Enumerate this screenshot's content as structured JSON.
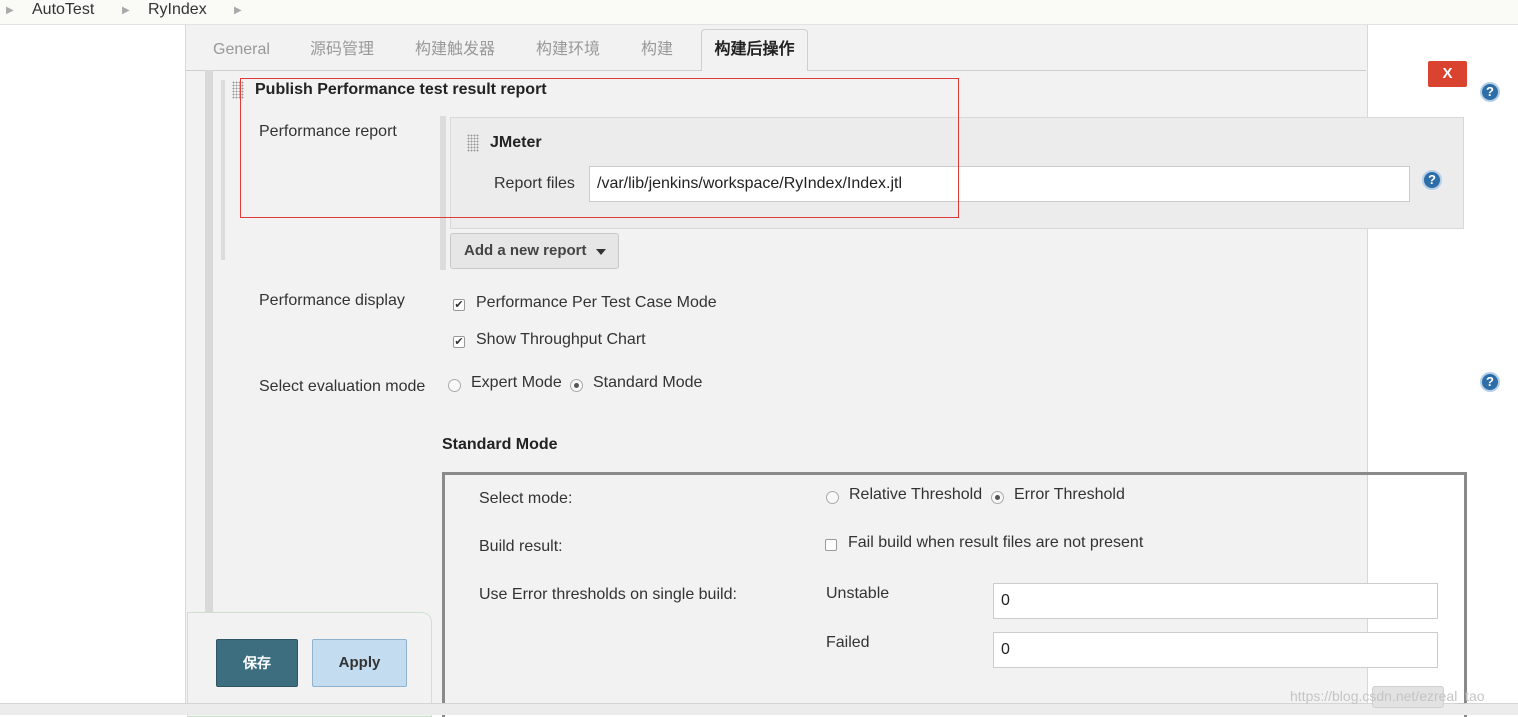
{
  "breadcrumb": {
    "items": [
      "AutoTest",
      "RyIndex"
    ]
  },
  "tabs": {
    "general": "General",
    "scm": "源码管理",
    "triggers": "构建触发器",
    "env": "构建环境",
    "build": "构建",
    "post_build": "构建后操作"
  },
  "close_label": "X",
  "publisher": {
    "title": "Publish Performance test result report",
    "performance_report_label": "Performance report",
    "jmeter_title": "JMeter",
    "report_files_label": "Report files",
    "report_files_value": "/var/lib/jenkins/workspace/RyIndex/Index.jtl",
    "add_report_label": "Add a new report",
    "performance_display_label": "Performance display",
    "per_test_case_label": "Performance Per Test Case Mode",
    "per_test_case_checked": true,
    "throughput_label": "Show Throughput Chart",
    "throughput_checked": true,
    "eval_mode_label": "Select evaluation mode",
    "expert_mode_label": "Expert Mode",
    "standard_mode_label": "Standard Mode",
    "eval_mode_selected": "Standard Mode"
  },
  "standard_mode": {
    "heading": "Standard Mode",
    "select_mode_label": "Select mode:",
    "relative_threshold_label": "Relative Threshold",
    "error_threshold_label": "Error Threshold",
    "mode_selected": "Error Threshold",
    "build_result_label": "Build result:",
    "fail_build_label": "Fail build when result files are not present",
    "fail_build_checked": false,
    "error_thresholds_label": "Use Error thresholds on single build:",
    "unstable_label": "Unstable",
    "unstable_value": "0",
    "failed_label": "Failed",
    "failed_value": "0"
  },
  "actions": {
    "save_label": "保存",
    "apply_label": "Apply"
  },
  "help_icon_glyph": "?",
  "watermark": "https://blog.csdn.net/ezreal_tao",
  "colors": {
    "close": "#d9432f",
    "save": "#3d6e80",
    "apply": "#c3dcef",
    "help": "#2d6da8",
    "highlight": "#e03a3a"
  }
}
